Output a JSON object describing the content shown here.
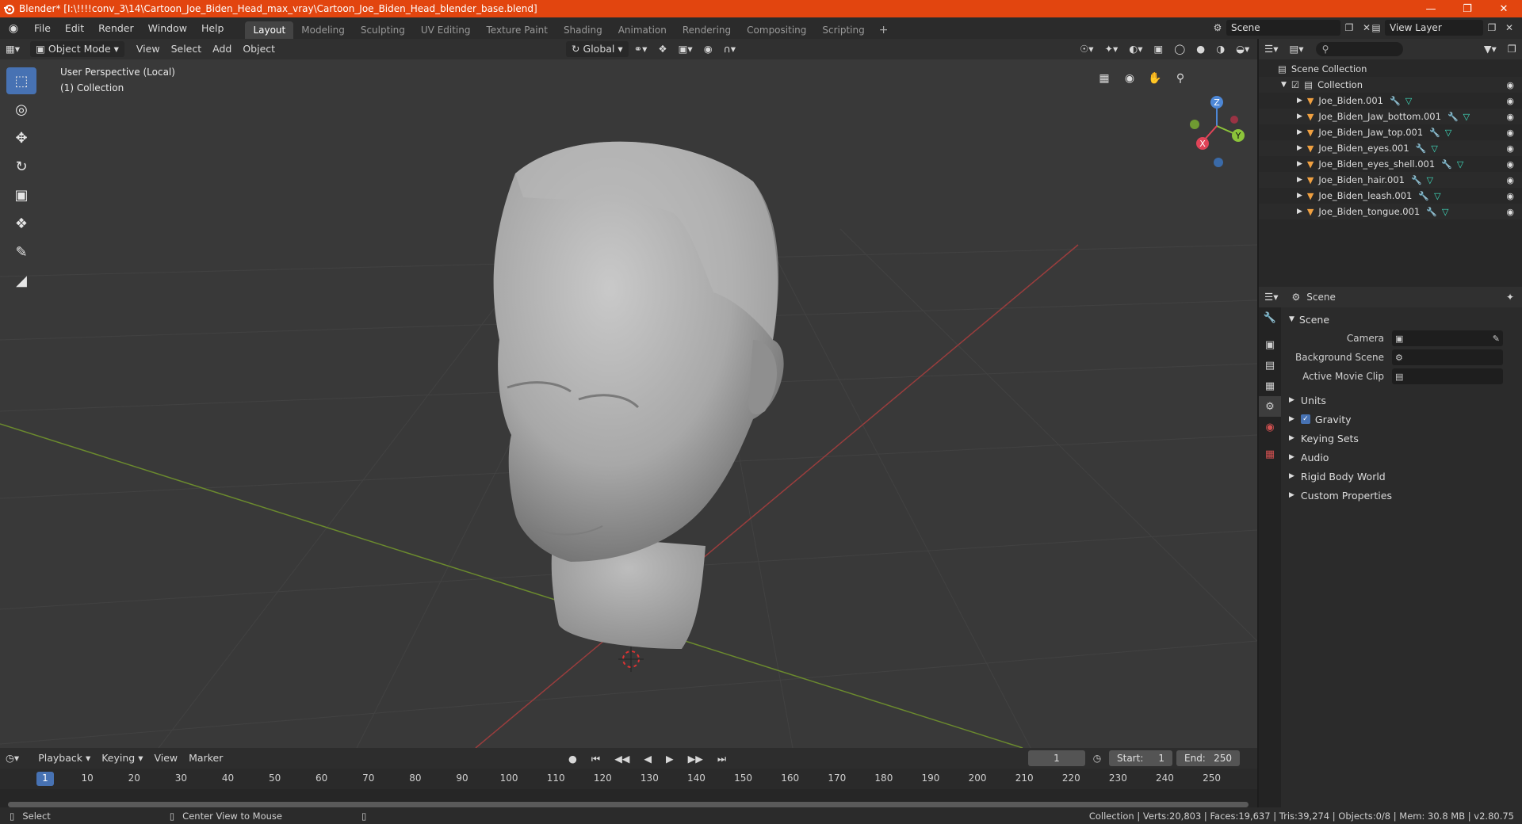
{
  "titlebar": {
    "title": "Blender* [I:\\!!!!conv_3\\14\\Cartoon_Joe_Biden_Head_max_vray\\Cartoon_Joe_Biden_Head_blender_base.blend]"
  },
  "menu": {
    "items": [
      "File",
      "Edit",
      "Render",
      "Window",
      "Help"
    ]
  },
  "workspaces": [
    "Layout",
    "Modeling",
    "Sculpting",
    "UV Editing",
    "Texture Paint",
    "Shading",
    "Animation",
    "Rendering",
    "Compositing",
    "Scripting"
  ],
  "active_workspace": "Layout",
  "scene_selector": {
    "value": "Scene"
  },
  "view_layer_selector": {
    "value": "View Layer"
  },
  "viewport": {
    "mode": "Object Mode",
    "menus": [
      "View",
      "Select",
      "Add",
      "Object"
    ],
    "transform_orientation": "Global",
    "info_line1": "User Perspective (Local)",
    "info_line2": "(1) Collection",
    "axis_x": "X",
    "axis_y": "Y",
    "axis_z": "Z"
  },
  "timeline": {
    "menus": [
      "Playback",
      "Keying",
      "View",
      "Marker"
    ],
    "current_frame": "1",
    "start_label": "Start:",
    "start_value": "1",
    "end_label": "End:",
    "end_value": "250",
    "ticks": [
      "1",
      "10",
      "20",
      "30",
      "40",
      "50",
      "60",
      "70",
      "80",
      "90",
      "100",
      "110",
      "120",
      "130",
      "140",
      "150",
      "160",
      "170",
      "180",
      "190",
      "200",
      "210",
      "220",
      "230",
      "240",
      "250"
    ]
  },
  "statusbar": {
    "select": "Select",
    "center_view": "Center View to Mouse",
    "stats": "Collection | Verts:20,803 | Faces:19,637 | Tris:39,274 | Objects:0/8 | Mem: 30.8 MB | v2.80.75"
  },
  "outliner": {
    "root": "Scene Collection",
    "collection": "Collection",
    "objects": [
      "Joe_Biden.001",
      "Joe_Biden_Jaw_bottom.001",
      "Joe_Biden_Jaw_top.001",
      "Joe_Biden_eyes.001",
      "Joe_Biden_eyes_shell.001",
      "Joe_Biden_hair.001",
      "Joe_Biden_leash.001",
      "Joe_Biden_tongue.001"
    ]
  },
  "properties": {
    "context": "Scene",
    "panel_title": "Scene",
    "camera_label": "Camera",
    "background_scene_label": "Background Scene",
    "active_movie_clip_label": "Active Movie Clip",
    "panels": [
      "Units",
      "Gravity",
      "Keying Sets",
      "Audio",
      "Rigid Body World",
      "Custom Properties"
    ]
  },
  "colors": {
    "titlebar": "#e2450f",
    "accent": "#4772b3",
    "viewport_bg": "#393939"
  }
}
